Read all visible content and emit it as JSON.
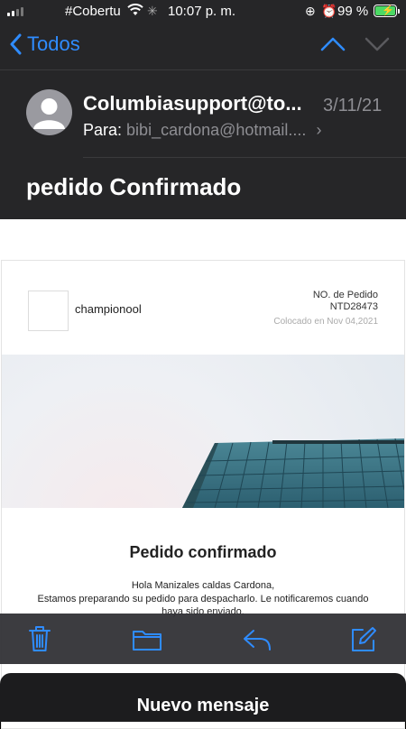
{
  "status_bar": {
    "carrier": "#Cobertura",
    "time": "10:07 p. m.",
    "battery_percent": "99 %",
    "battery_level": 0.99,
    "icons": [
      "signal-icon",
      "wifi-icon",
      "activity-spinner-icon",
      "rotation-lock-icon",
      "alarm-icon",
      "battery-charging-icon"
    ]
  },
  "nav": {
    "back_label": "Todos",
    "icons": [
      "chevron-left-icon",
      "chevron-up-icon",
      "chevron-down-icon"
    ]
  },
  "email": {
    "sender": "Columbiasupport@to...",
    "date": "3/11/21",
    "to_label": "Para:",
    "to_address": "bibi_cardona@hotmail....",
    "subject": "pedido Confirmado"
  },
  "message": {
    "shop_name": "championool",
    "order_label": "NO. de Pedido",
    "order_number": "NTD28473",
    "placed_on": "Colocado en Nov 04,2021",
    "confirm_title": "Pedido confirmado",
    "greeting": "Hola Manizales caldas Cardona,",
    "body_text": "Estamos preparando su pedido para despacharlo. Le notificaremos cuando haya sido enviado."
  },
  "toolbar": {
    "icons": [
      "trash-icon",
      "folder-icon",
      "reply-icon",
      "compose-icon"
    ]
  },
  "draft": {
    "title": "Nuevo mensaje"
  },
  "colors": {
    "accent": "#2f8cff",
    "header_bg": "#262628",
    "battery_green": "#4cd964"
  }
}
